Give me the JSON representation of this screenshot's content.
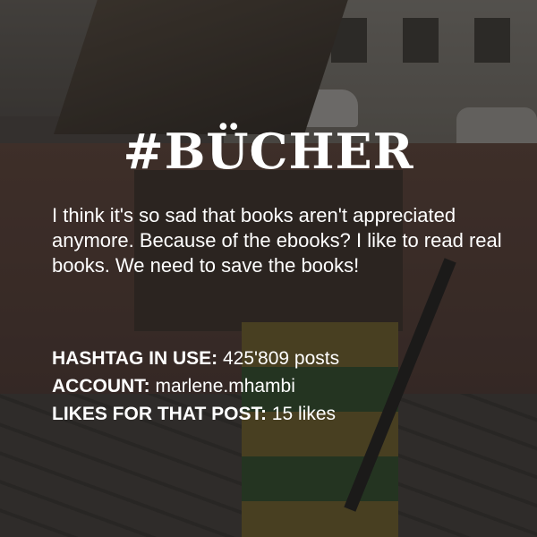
{
  "title": "#BÜCHER",
  "quote": "I think it's so sad that books aren't appreciated anymore. Because of the ebooks? I like to read real books. We need to save the books!",
  "stats": [
    {
      "label": "HASHTAG IN USE:",
      "value": "425'809 posts"
    },
    {
      "label": "ACCOUNT:",
      "value": "marlene.mhambi"
    },
    {
      "label": "LIKES FOR THAT POST:",
      "value": "15 likes"
    }
  ]
}
